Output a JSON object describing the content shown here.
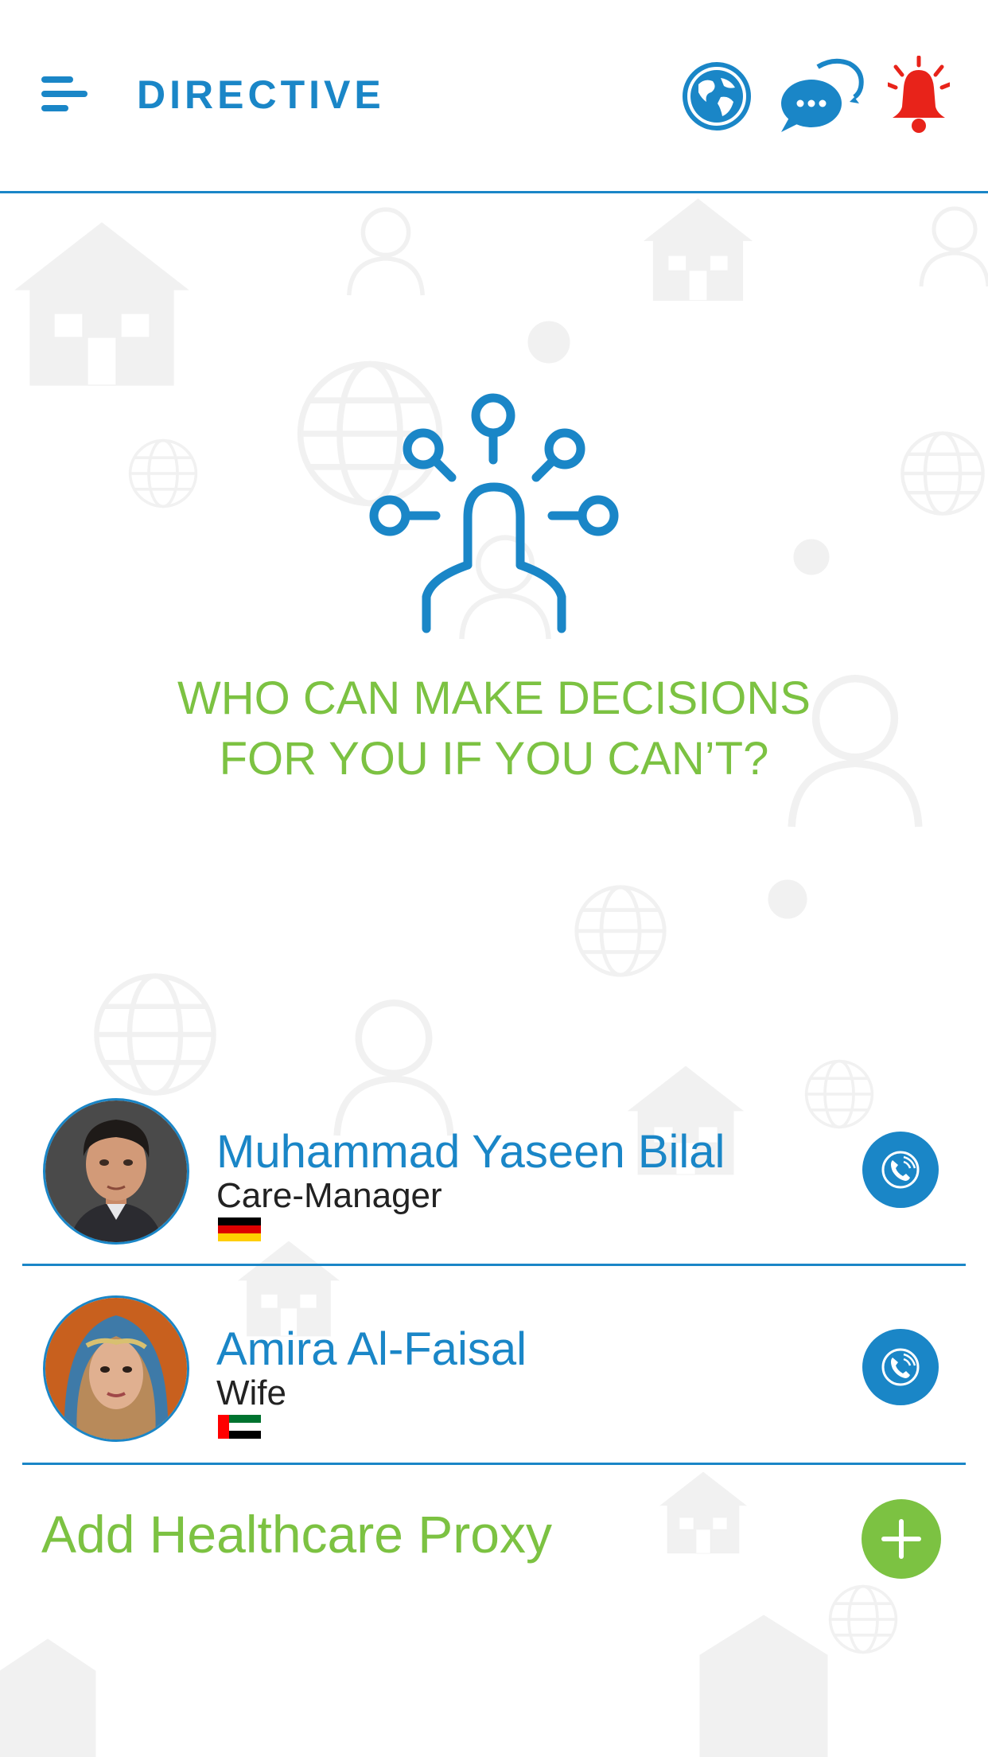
{
  "header": {
    "title": "DIRECTIVE",
    "menu_icon": "hamburger-menu-icon",
    "language_icon": "globe-icon",
    "chat_icon": "chat-bubbles-icon",
    "alert_icon": "alarm-bell-icon"
  },
  "hero": {
    "icon": "decision-network-person-icon",
    "question": "WHO CAN MAKE DECISIONS\nFOR YOU IF YOU CAN’T?"
  },
  "proxies": [
    {
      "name": "Muhammad Yaseen Bilal",
      "role": "Care-Manager",
      "flag": "germany-flag-icon"
    },
    {
      "name": "Amira Al-Faisal",
      "role": "Wife",
      "flag": "uae-flag-icon"
    }
  ],
  "add_proxy": {
    "label": "Add Healthcare Proxy",
    "icon": "plus-icon"
  },
  "colors": {
    "primary": "#1a86c7",
    "accent": "#7cc242",
    "alert": "#e8231a"
  }
}
